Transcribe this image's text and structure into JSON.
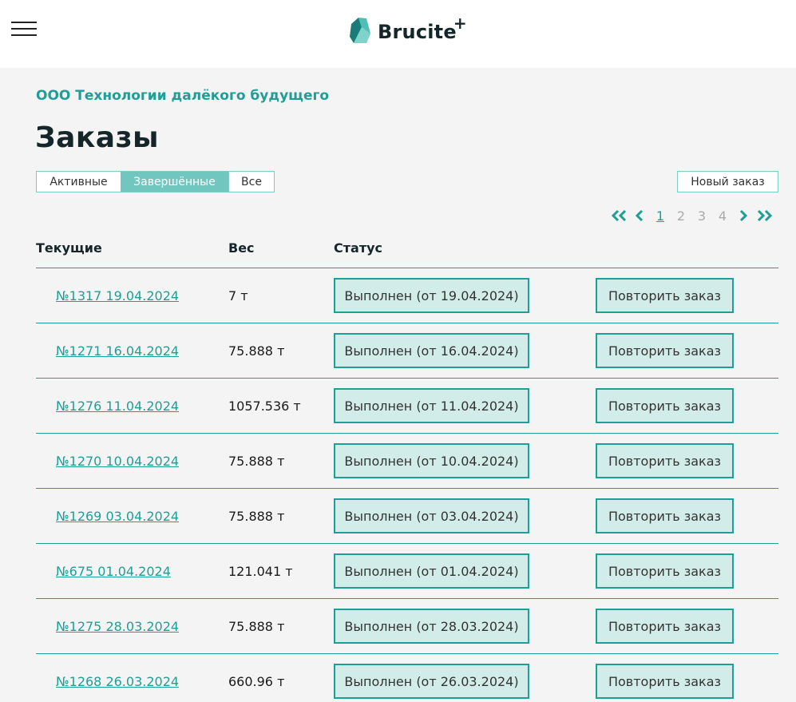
{
  "header": {
    "brand": "Brucite",
    "brand_plus": "+"
  },
  "company": "ООО Технологии далёкого будущего",
  "page_title": "Заказы",
  "tabs": [
    {
      "label": "Активные",
      "active": false
    },
    {
      "label": "Завершённые",
      "active": true
    },
    {
      "label": "Все",
      "active": false
    }
  ],
  "new_order_label": "Новый заказ",
  "pagination": {
    "pages": [
      "1",
      "2",
      "3",
      "4"
    ],
    "current": "1"
  },
  "columns": {
    "current": "Текущие",
    "weight": "Вес",
    "status": "Статус"
  },
  "orders": [
    {
      "order": "№1317 19.04.2024",
      "weight": "7 т",
      "status": "Выполнен (от 19.04.2024)",
      "action": "Повторить заказ"
    },
    {
      "order": "№1271 16.04.2024",
      "weight": "75.888 т",
      "status": "Выполнен (от 16.04.2024)",
      "action": "Повторить заказ"
    },
    {
      "order": "№1276 11.04.2024",
      "weight": "1057.536 т",
      "status": "Выполнен (от 11.04.2024)",
      "action": "Повторить заказ"
    },
    {
      "order": "№1270 10.04.2024",
      "weight": "75.888 т",
      "status": "Выполнен (от 10.04.2024)",
      "action": "Повторить заказ"
    },
    {
      "order": "№1269 03.04.2024",
      "weight": "75.888 т",
      "status": "Выполнен (от 03.04.2024)",
      "action": "Повторить заказ"
    },
    {
      "order": "№675 01.04.2024",
      "weight": "121.041 т",
      "status": "Выполнен (от 01.04.2024)",
      "action": "Повторить заказ"
    },
    {
      "order": "№1275 28.03.2024",
      "weight": "75.888 т",
      "status": "Выполнен (от 28.03.2024)",
      "action": "Повторить заказ"
    },
    {
      "order": "№1268 26.03.2024",
      "weight": "660.96 т",
      "status": "Выполнен (от 26.03.2024)",
      "action": "Повторить заказ"
    }
  ],
  "colors": {
    "accent": "#1f9e96",
    "tab_active": "#71c6c0",
    "button_fill": "#d2ecea",
    "page_bg": "#f4f4f4"
  },
  "icons": {
    "menu": "hamburger-menu-icon",
    "logo": "crystal-logo-icon",
    "first": "double-chevron-left-icon",
    "prev": "chevron-left-icon",
    "next": "chevron-right-icon",
    "last": "double-chevron-right-icon"
  }
}
